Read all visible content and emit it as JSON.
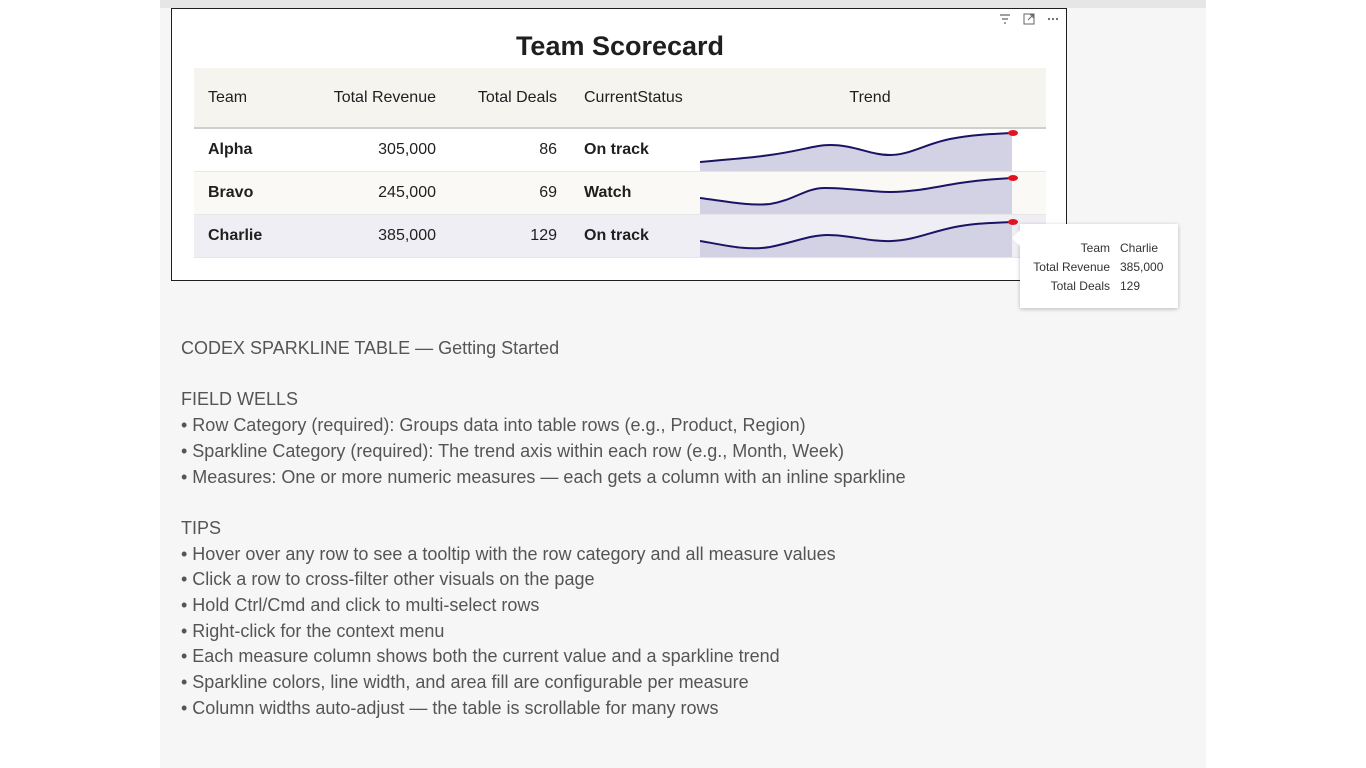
{
  "visual": {
    "title": "Team Scorecard",
    "header_icons": [
      "filter-icon",
      "focus-mode-icon",
      "more-options-icon"
    ]
  },
  "table": {
    "columns": [
      "Team",
      "Total Revenue",
      "Total Deals",
      "CurrentStatus",
      "Trend"
    ],
    "rows": [
      {
        "team": "Alpha",
        "revenue": "305,000",
        "deals": "86",
        "status": "On track"
      },
      {
        "team": "Bravo",
        "revenue": "245,000",
        "deals": "69",
        "status": "Watch"
      },
      {
        "team": "Charlie",
        "revenue": "385,000",
        "deals": "129",
        "status": "On track"
      }
    ],
    "sparkline_color": "#1a1464",
    "sparkline_fill": "#d3d1e4",
    "endpoint_color": "#e0141e"
  },
  "tooltip": {
    "rows": [
      {
        "label": "Team",
        "value": "Charlie"
      },
      {
        "label": "Total Revenue",
        "value": "385,000"
      },
      {
        "label": "Total Deals",
        "value": "129"
      }
    ]
  },
  "help": {
    "heading": "CODEX SPARKLINE TABLE — Getting Started",
    "field_wells_title": "FIELD WELLS",
    "field_wells": [
      "• Row Category (required): Groups data into table rows (e.g., Product, Region)",
      "• Sparkline Category (required): The trend axis within each row (e.g., Month, Week)",
      "• Measures: One or more numeric measures — each gets a column with an inline sparkline"
    ],
    "tips_title": "TIPS",
    "tips": [
      "• Hover over any row to see a tooltip with the row category and all measure values",
      "• Click a row to cross-filter other visuals on the page",
      "• Hold Ctrl/Cmd and click to multi-select rows",
      "• Right-click for the context menu",
      "• Each measure column shows both the current value and a sparkline trend",
      "• Sparkline colors, line width, and area fill are configurable per measure",
      "• Column widths auto-adjust — the table is scrollable for many rows"
    ]
  }
}
